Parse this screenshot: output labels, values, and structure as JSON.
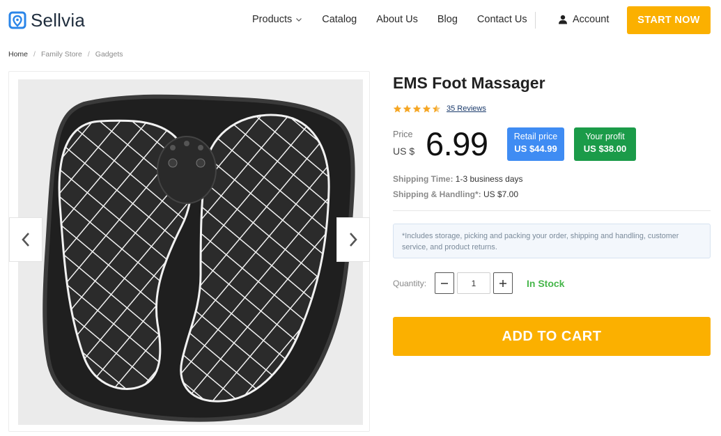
{
  "header": {
    "logo_text": "Sellvia",
    "nav": [
      {
        "label": "Products",
        "has_dropdown": true
      },
      {
        "label": "Catalog"
      },
      {
        "label": "About Us"
      },
      {
        "label": "Blog"
      },
      {
        "label": "Contact Us"
      }
    ],
    "account_label": "Account",
    "start_button": "START NOW"
  },
  "breadcrumb": [
    "Home",
    "Family Store",
    "Gadgets"
  ],
  "gallery": {
    "image_alt": "EMS Foot Massager mat",
    "prev_icon": "chevron-left-icon",
    "next_icon": "chevron-right-icon"
  },
  "product": {
    "title": "EMS Foot Massager",
    "rating": 4.5,
    "reviews_label": "35 Reviews",
    "price_label": "Price",
    "currency": "US $",
    "price": "6.99",
    "retail": {
      "label": "Retail price",
      "value": "US $44.99"
    },
    "profit": {
      "label": "Your profit",
      "value": "US $38.00"
    },
    "shipping_time": {
      "label": "Shipping Time:",
      "value": "1-3 business days"
    },
    "shipping_handling": {
      "label": "Shipping & Handling*:",
      "value": "US $7.00"
    },
    "note": "*Includes storage, picking and packing your order, shipping and handling, customer service, and product returns.",
    "quantity_label": "Quantity:",
    "quantity": "1",
    "stock_status": "In Stock",
    "add_to_cart": "ADD TO CART"
  },
  "colors": {
    "accent": "#fbb000",
    "retail_badge": "#3f8cf3",
    "profit_badge": "#1b9b49",
    "in_stock": "#46b64a",
    "star": "#f5a623"
  }
}
